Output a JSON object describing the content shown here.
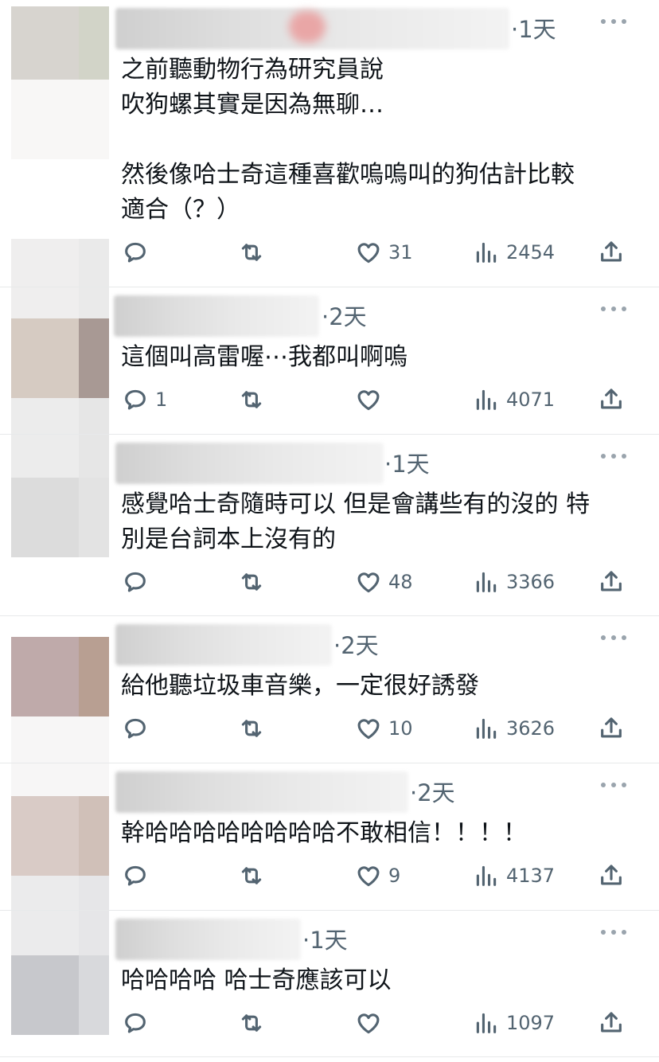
{
  "comments": [
    {
      "time": "·1天",
      "text": "之前聽動物行為研究員說\n吹狗螺其實是因為無聊…\n\n然後像哈士奇這種喜歡嗚嗚叫的狗估計比較\n適合（？）",
      "replies": "",
      "likes": "31",
      "views": "2454"
    },
    {
      "time": "·2天",
      "text": "這個叫高雷喔⋯我都叫啊嗚",
      "replies": "1",
      "likes": "",
      "views": "4071"
    },
    {
      "time": "·1天",
      "text": "感覺哈士奇隨時可以 但是會講些有的沒的 特\n別是台詞本上沒有的",
      "replies": "",
      "likes": "48",
      "views": "3366"
    },
    {
      "time": "·2天",
      "text": "給他聽垃圾車音樂，一定很好誘發",
      "replies": "",
      "likes": "10",
      "views": "3626"
    },
    {
      "time": "·2天",
      "text": "幹哈哈哈哈哈哈哈哈不敢相信！！！！",
      "replies": "",
      "likes": "9",
      "views": "4137"
    },
    {
      "time": "·1天",
      "text": "哈哈哈哈 哈士奇應該可以",
      "replies": "",
      "likes": "",
      "views": "1097"
    }
  ],
  "icons": {
    "reply": "reply-icon",
    "retweet": "retweet-icon",
    "like": "heart-icon",
    "views": "views-icon",
    "share": "share-icon",
    "more": "more-icon"
  },
  "colors": {
    "secondary_text": "#536471",
    "separator": "#e7e9ea"
  }
}
